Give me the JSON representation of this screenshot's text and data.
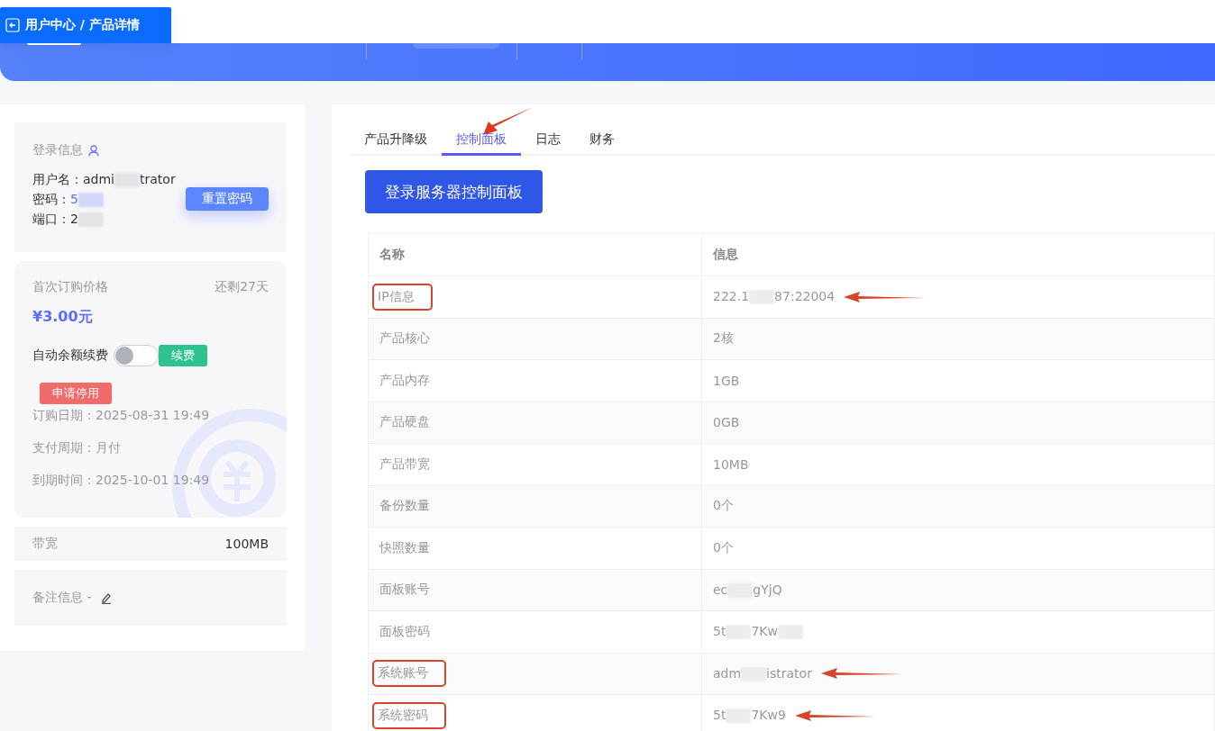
{
  "breadcrumb": {
    "label": "用户中心 / 产品详情"
  },
  "login_info": {
    "title": "登录信息",
    "fields": [
      {
        "label": "用户名：",
        "parts": [
          "admi",
          "trator"
        ],
        "kind": "plain"
      },
      {
        "label": "密码：",
        "parts": [
          "5"
        ],
        "blur_after": true,
        "kind": "link"
      },
      {
        "label": "端口：",
        "parts": [
          "2"
        ],
        "blur_after": true,
        "kind": "plain"
      }
    ],
    "reset_button": "重置密码"
  },
  "price_card": {
    "title": "首次订购价格",
    "remaining": "还剩27天",
    "price": "¥3.00元",
    "auto_renew": {
      "label": "自动余额续费",
      "on": false
    },
    "renew_button": "续费",
    "stop_button": "申请停用",
    "details": [
      {
        "label": "订购日期：",
        "value": "2025-08-31 19:49"
      },
      {
        "label": "支付周期：",
        "value": "月付"
      },
      {
        "label": "到期时间：",
        "value": "2025-10-01 19:49"
      }
    ]
  },
  "bandwidth": {
    "label": "带宽",
    "value": "100MB"
  },
  "notes": {
    "label": "备注信息",
    "value": "-"
  },
  "tabs": [
    {
      "label": "产品升降级",
      "selected": false,
      "annotated": false
    },
    {
      "label": "控制面板",
      "selected": true,
      "annotated": true
    },
    {
      "label": "日志",
      "selected": false,
      "annotated": false
    },
    {
      "label": "财务",
      "selected": false,
      "annotated": false
    }
  ],
  "panel_button": "登录服务器控制面板",
  "table": {
    "columns": [
      "名称",
      "信息"
    ],
    "rows": [
      {
        "name": "IP信息",
        "parts": [
          "222.1",
          "87:22004"
        ],
        "annotated": true
      },
      {
        "name": "产品核心",
        "parts": [
          "2核"
        ],
        "annotated": false
      },
      {
        "name": "产品内存",
        "parts": [
          "1GB"
        ],
        "annotated": false
      },
      {
        "name": "产品硬盘",
        "parts": [
          "0GB"
        ],
        "annotated": false
      },
      {
        "name": "产品带宽",
        "parts": [
          "10MB"
        ],
        "annotated": false
      },
      {
        "name": "备份数量",
        "parts": [
          "0个"
        ],
        "annotated": false
      },
      {
        "name": "快照数量",
        "parts": [
          "0个"
        ],
        "annotated": false
      },
      {
        "name": "面板账号",
        "parts": [
          "ec",
          "gYjQ"
        ],
        "annotated": false
      },
      {
        "name": "面板密码",
        "parts": [
          "5t",
          "7Kw"
        ],
        "blur_after": true,
        "annotated": false
      },
      {
        "name": "系统账号",
        "parts": [
          "adm",
          "istrator"
        ],
        "annotated": true
      },
      {
        "name": "系统密码",
        "parts": [
          "5t",
          "7Kw9"
        ],
        "annotated": true
      }
    ]
  }
}
